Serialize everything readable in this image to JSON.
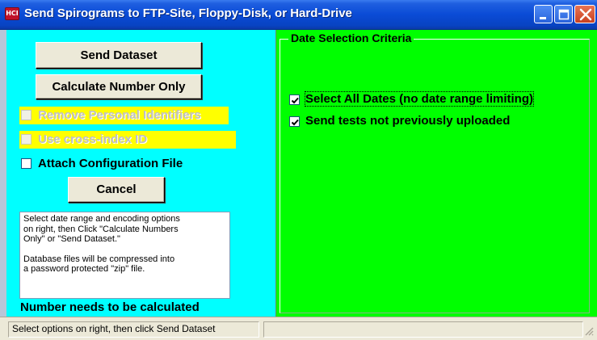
{
  "window": {
    "title": "Send Spirograms to FTP-Site, Floppy-Disk, or Hard-Drive",
    "icon_text": "HCI",
    "icon": "app-icon",
    "controls": [
      "minimize-icon",
      "maximize-icon",
      "close-icon"
    ]
  },
  "left": {
    "send_label": "Send Dataset",
    "calc_label": "Calculate Number Only",
    "options": [
      {
        "label": "Remove Personal Identifiers",
        "checked": false,
        "enabled": false
      },
      {
        "label": "Use cross-index ID",
        "checked": false,
        "enabled": false
      },
      {
        "label": "Attach Configuration File",
        "checked": false,
        "enabled": true
      }
    ],
    "cancel_label": "Cancel",
    "info_line1": "Select date range and encoding options",
    "info_line2": "on right, then Click \"Calculate Numbers",
    "info_line3": "Only\" or \"Send Dataset.\"",
    "info_line4": "Database files will be compressed into",
    "info_line5": "a password protected \"zip\" file.",
    "status_text": "Number needs to be calculated"
  },
  "right": {
    "group_title": "Date Selection Criteria",
    "options": [
      {
        "label": "Select All Dates (no date range limiting)",
        "checked": true
      },
      {
        "label": "Send tests not previously uploaded",
        "checked": true
      }
    ]
  },
  "statusbar": {
    "message": "Select options on right, then click Send Dataset",
    "pane2": ""
  },
  "colors": {
    "left_panel": "#00ffff",
    "right_panel": "#00ff00",
    "disabled_highlight": "#ffff00",
    "titlebar": "#0a4bd6"
  }
}
